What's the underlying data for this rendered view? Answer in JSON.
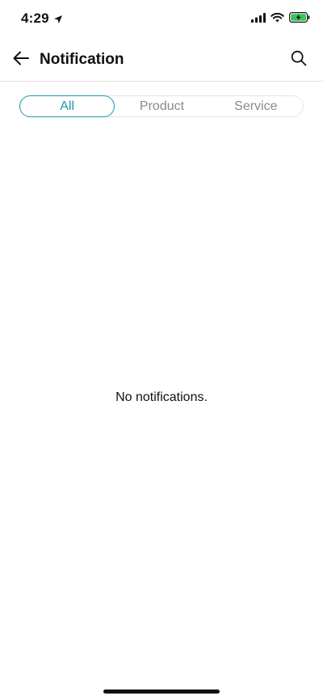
{
  "status_bar": {
    "time": "4:29",
    "icons": [
      "location-arrow-icon",
      "signal-icon",
      "wifi-icon",
      "battery-charging-icon"
    ]
  },
  "header": {
    "title": "Notification",
    "back_icon": "arrow-left-icon",
    "search_icon": "search-icon"
  },
  "tabs": [
    {
      "label": "All",
      "active": true
    },
    {
      "label": "Product",
      "active": false
    },
    {
      "label": "Service",
      "active": false
    }
  ],
  "empty_state": {
    "message": "No notifications."
  },
  "colors": {
    "accent": "#1a9aaa",
    "inactive_tab_text": "#8a8a8a",
    "battery_green": "#35c759",
    "divider": "#e3e3e3"
  }
}
